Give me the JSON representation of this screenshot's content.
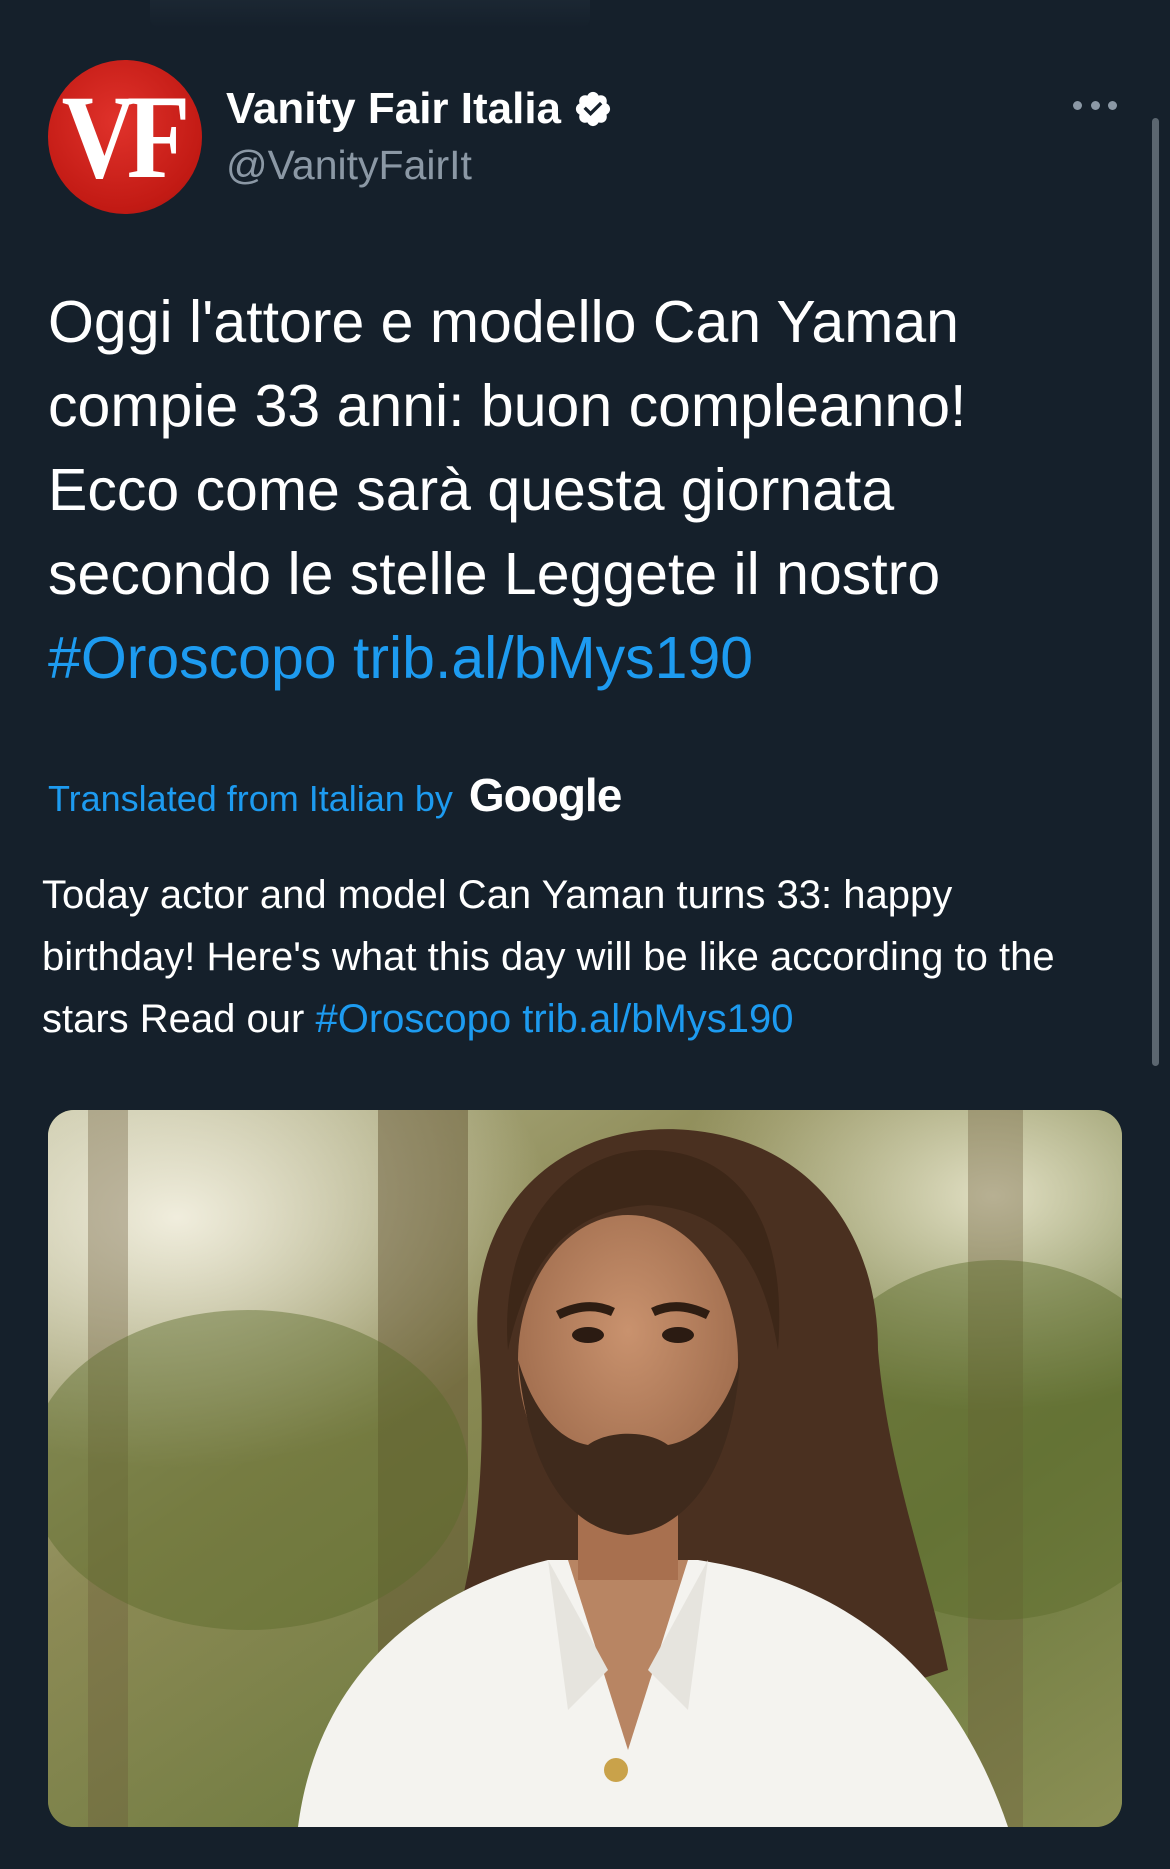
{
  "account": {
    "avatar_text": "VF",
    "display_name": "Vanity Fair Italia",
    "handle": "@VanityFairIt",
    "verified": true
  },
  "tweet": {
    "text_plain": "Oggi l'attore e modello Can Yaman compie 33 anni: buon compleanno! Ecco come sarà questa giornata secondo le stelle Leggete il nostro",
    "hashtag": "#Oroscopo",
    "link": "trib.al/bMys190"
  },
  "translation": {
    "label": "Translated from Italian by",
    "provider": "Google",
    "text_plain": "Today actor and model Can Yaman turns 33: happy birthday! Here's what this day will be like according to the stars Read our",
    "hashtag": "#Oroscopo",
    "link": "trib.al/bMys190"
  },
  "icons": {
    "verified": "verified-badge-icon",
    "more": "more-options-icon"
  },
  "colors": {
    "background": "#15202b",
    "link": "#1d9bf0",
    "secondary_text": "#8b98a5",
    "avatar_red": "#c21a14"
  }
}
